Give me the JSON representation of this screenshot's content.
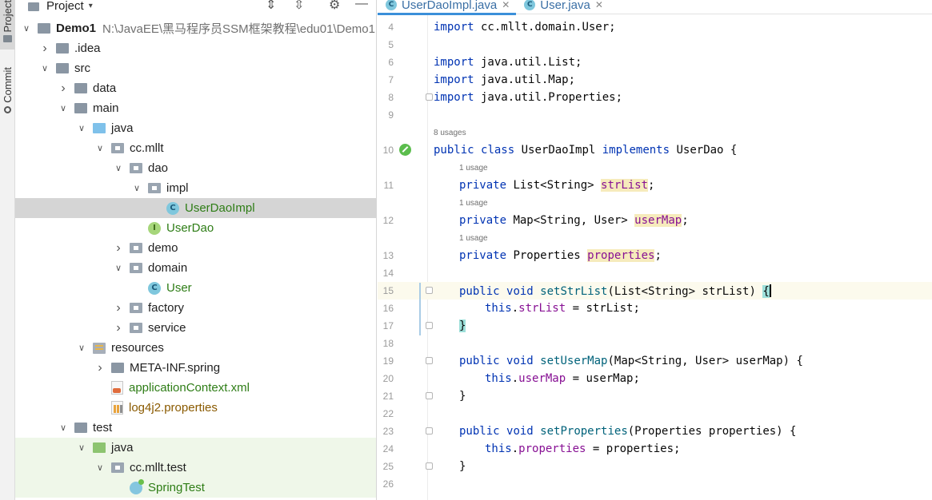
{
  "sidebar": {
    "project_tab": "Project",
    "commit_tab": "Commit"
  },
  "project_panel": {
    "title": "Project",
    "root_name": "Demo1",
    "root_path": "N:\\JavaEE\\黑马程序员SSM框架教程\\edu01\\Demo1",
    "tree": [
      {
        "label": "Demo1",
        "depth": 0,
        "arrow": "open",
        "icon": "folder"
      },
      {
        "label": ".idea",
        "depth": 1,
        "arrow": "closed",
        "icon": "folder"
      },
      {
        "label": "src",
        "depth": 1,
        "arrow": "open",
        "icon": "folder"
      },
      {
        "label": "data",
        "depth": 2,
        "arrow": "closed",
        "icon": "folder"
      },
      {
        "label": "main",
        "depth": 2,
        "arrow": "open",
        "icon": "folder"
      },
      {
        "label": "java",
        "depth": 3,
        "arrow": "open",
        "icon": "folder-blue"
      },
      {
        "label": "cc.mllt",
        "depth": 4,
        "arrow": "open",
        "icon": "package"
      },
      {
        "label": "dao",
        "depth": 5,
        "arrow": "open",
        "icon": "package"
      },
      {
        "label": "impl",
        "depth": 6,
        "arrow": "open",
        "icon": "package"
      },
      {
        "label": "UserDaoImpl",
        "depth": 7,
        "arrow": "none",
        "icon": "class"
      },
      {
        "label": "UserDao",
        "depth": 6,
        "arrow": "none",
        "icon": "interface"
      },
      {
        "label": "demo",
        "depth": 5,
        "arrow": "closed",
        "icon": "package"
      },
      {
        "label": "domain",
        "depth": 5,
        "arrow": "open",
        "icon": "package"
      },
      {
        "label": "User",
        "depth": 6,
        "arrow": "none",
        "icon": "class"
      },
      {
        "label": "factory",
        "depth": 5,
        "arrow": "closed",
        "icon": "package"
      },
      {
        "label": "service",
        "depth": 5,
        "arrow": "closed",
        "icon": "package"
      },
      {
        "label": "resources",
        "depth": 3,
        "arrow": "open",
        "icon": "resources"
      },
      {
        "label": "META-INF.spring",
        "depth": 4,
        "arrow": "closed",
        "icon": "folder"
      },
      {
        "label": "applicationContext.xml",
        "depth": 4,
        "arrow": "none",
        "icon": "xml"
      },
      {
        "label": "log4j2.properties",
        "depth": 4,
        "arrow": "none",
        "icon": "properties"
      },
      {
        "label": "test",
        "depth": 2,
        "arrow": "open",
        "icon": "folder"
      },
      {
        "label": "java",
        "depth": 3,
        "arrow": "open",
        "icon": "folder-green"
      },
      {
        "label": "cc.mllt.test",
        "depth": 4,
        "arrow": "open",
        "icon": "package"
      },
      {
        "label": "SpringTest",
        "depth": 5,
        "arrow": "none",
        "icon": "spring-class"
      }
    ]
  },
  "editor": {
    "tabs": [
      {
        "name": "UserDaoImpl.java",
        "active": true
      },
      {
        "name": "User.java",
        "active": false
      }
    ],
    "usage_hints": [
      "8 usages",
      "1 usage",
      "1 usage",
      "1 usage"
    ],
    "lines": [
      {
        "n": "4",
        "indent": 0,
        "text": "import cc.mllt.domain.User;"
      },
      {
        "n": "5",
        "indent": 0,
        "text": ""
      },
      {
        "n": "6",
        "indent": 0,
        "text": "import java.util.List;"
      },
      {
        "n": "7",
        "indent": 0,
        "text": "import java.util.Map;"
      },
      {
        "n": "8",
        "indent": 0,
        "text": "import java.util.Properties;"
      },
      {
        "n": "9",
        "indent": 0,
        "text": ""
      },
      {
        "n": "10",
        "indent": 0,
        "text": "public class UserDaoImpl implements UserDao {"
      },
      {
        "n": "11",
        "indent": 1,
        "text": "private List<String> strList;"
      },
      {
        "n": "12",
        "indent": 1,
        "text": "private Map<String, User> userMap;"
      },
      {
        "n": "13",
        "indent": 1,
        "text": "private Properties properties;"
      },
      {
        "n": "14",
        "indent": 0,
        "text": ""
      },
      {
        "n": "15",
        "indent": 1,
        "text": "public void setStrList(List<String> strList) {"
      },
      {
        "n": "16",
        "indent": 2,
        "text": "this.strList = strList;"
      },
      {
        "n": "17",
        "indent": 1,
        "text": "}"
      },
      {
        "n": "18",
        "indent": 0,
        "text": ""
      },
      {
        "n": "19",
        "indent": 1,
        "text": "public void setUserMap(Map<String, User> userMap) {"
      },
      {
        "n": "20",
        "indent": 2,
        "text": "this.userMap = userMap;"
      },
      {
        "n": "21",
        "indent": 1,
        "text": "}"
      },
      {
        "n": "22",
        "indent": 0,
        "text": ""
      },
      {
        "n": "23",
        "indent": 1,
        "text": "public void setProperties(Properties properties) {"
      },
      {
        "n": "24",
        "indent": 2,
        "text": "this.properties = properties;"
      },
      {
        "n": "25",
        "indent": 1,
        "text": "}"
      },
      {
        "n": "26",
        "indent": 0,
        "text": ""
      }
    ]
  },
  "colors": {
    "keyword": "#0033b3",
    "field": "#871094",
    "method": "#00627a",
    "selection": "#d5d5d5",
    "test_bg": "#eff7e9",
    "tab_accent": "#3b8fd9"
  }
}
